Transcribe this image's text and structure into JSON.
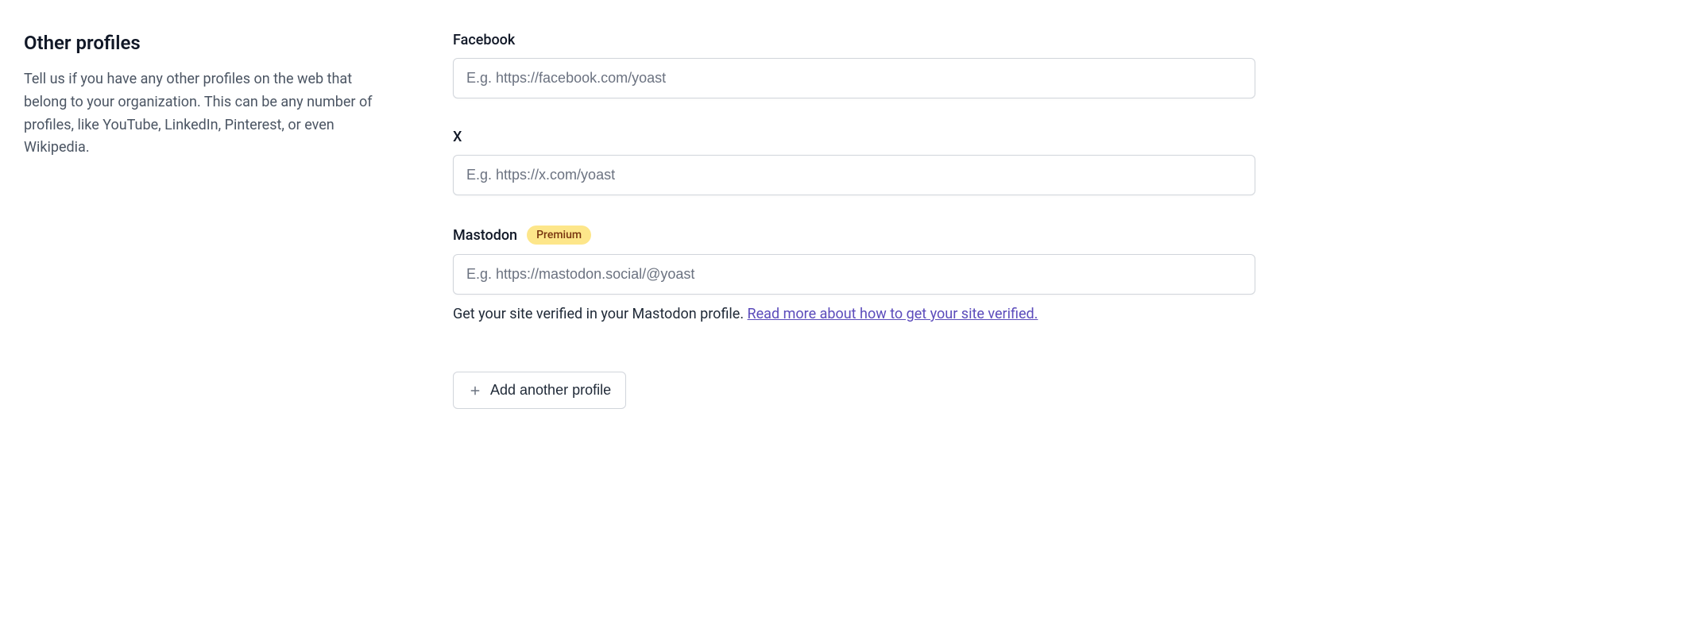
{
  "section": {
    "title": "Other profiles",
    "description": "Tell us if you have any other profiles on the web that belong to your organization. This can be any number of profiles, like YouTube, LinkedIn, Pinterest, or even Wikipedia."
  },
  "fields": {
    "facebook": {
      "label": "Facebook",
      "placeholder": "E.g. https://facebook.com/yoast",
      "value": ""
    },
    "x": {
      "label": "X",
      "placeholder": "E.g. https://x.com/yoast",
      "value": ""
    },
    "mastodon": {
      "label": "Mastodon",
      "badge": "Premium",
      "placeholder": "E.g. https://mastodon.social/@yoast",
      "value": "",
      "help_text": "Get your site verified in your Mastodon profile. ",
      "help_link_text": "Read more about how to get your site verified."
    }
  },
  "add_button": {
    "label": "Add another profile"
  }
}
